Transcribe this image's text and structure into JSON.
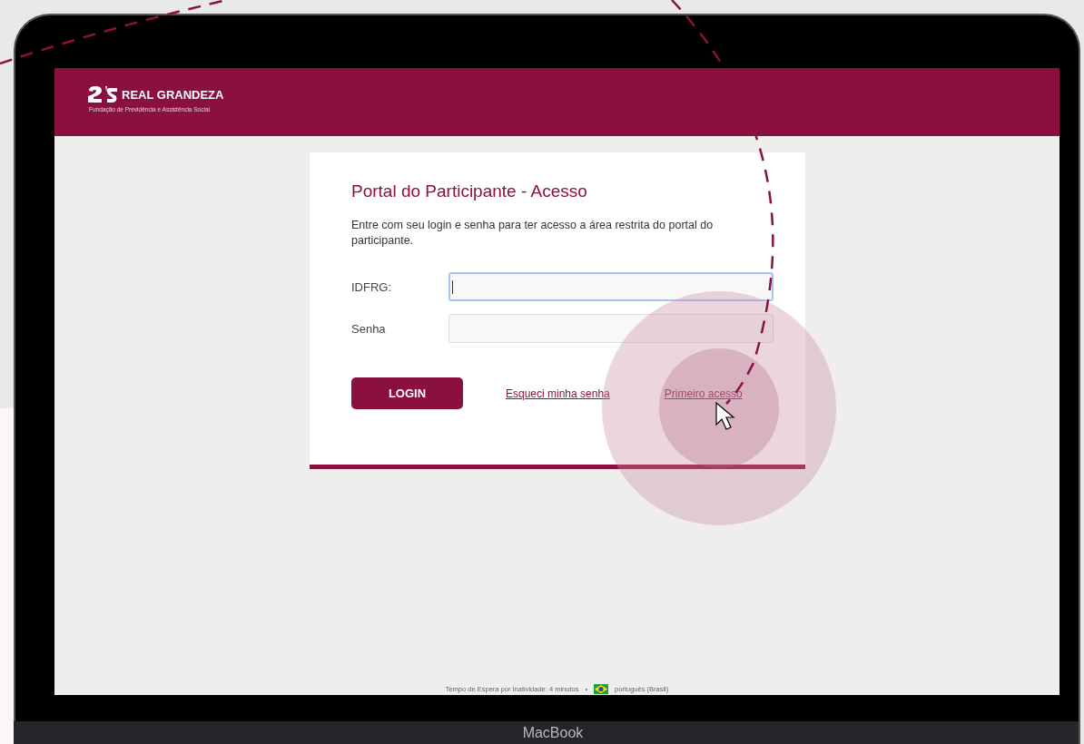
{
  "device": {
    "label": "MacBook"
  },
  "header": {
    "brand": "REAL GRANDEZA",
    "tagline": "Fundação de Previdência e Assistência Social"
  },
  "login_card": {
    "title": "Portal do Participante - Acesso",
    "description": "Entre com seu login e senha para ter acesso a área restrita do portal do participante.",
    "fields": [
      {
        "label": "IDFRG:",
        "focused": true
      },
      {
        "label": "Senha",
        "focused": false
      }
    ],
    "login_button": "LOGIN",
    "links": [
      "Esqueci minha senha",
      "Primeiro acesso"
    ]
  },
  "footer": {
    "timeout": "Tempo de Espera por Inatividade: 4 minutos",
    "separator": "•",
    "language": "português (Brasil)"
  }
}
